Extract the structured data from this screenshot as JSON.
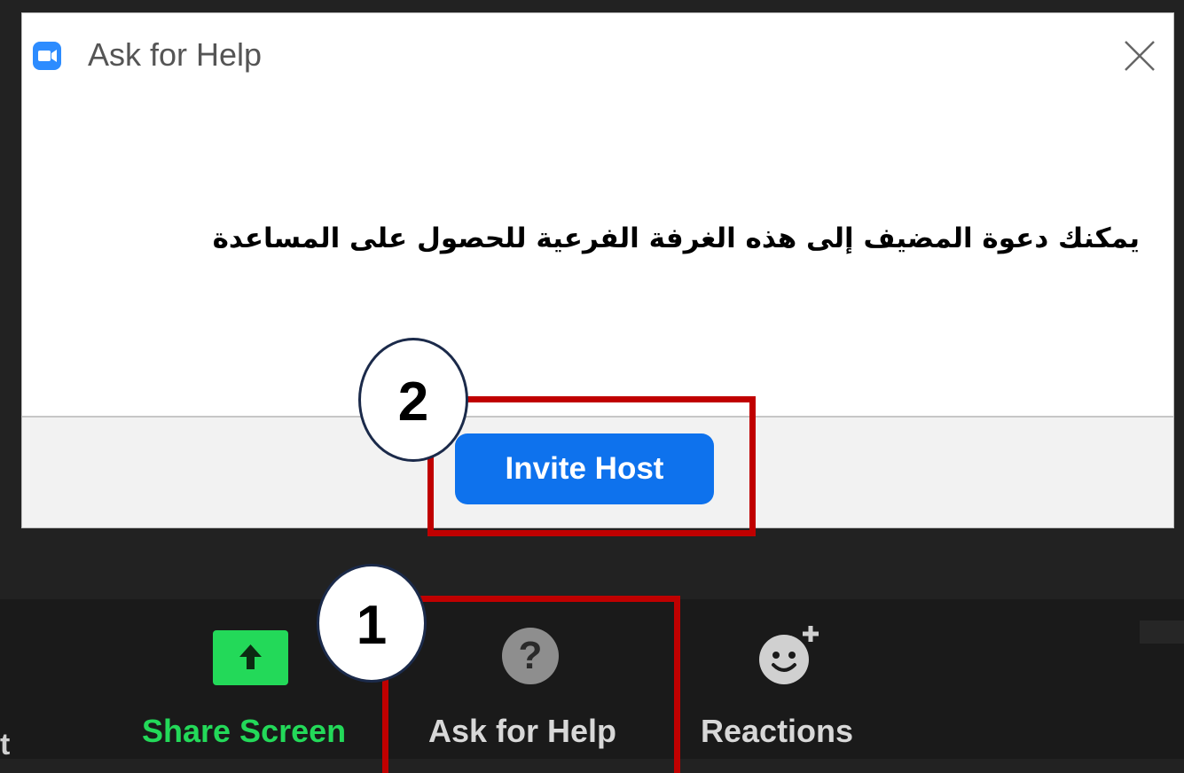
{
  "dialog": {
    "title": "Ask for Help",
    "message": "يمكنك دعوة المضيف إلى هذه الغرفة الفرعية للحصول على المساعدة",
    "invite_button": "Invite Host"
  },
  "annotations": {
    "step1": "1",
    "step2": "2",
    "highlight_color": "#c00000"
  },
  "toolbar": {
    "edge_text": "t",
    "share_screen": "Share Screen",
    "ask_for_help": "Ask for Help",
    "ask_for_help_icon": "?",
    "reactions": "Reactions"
  },
  "colors": {
    "zoom_blue": "#2d8cff",
    "invite_blue": "#0e72ed",
    "share_green": "#23d959"
  },
  "icons": [
    "zoom-logo-icon",
    "close-icon",
    "share-screen-icon",
    "help-icon",
    "reactions-icon"
  ]
}
